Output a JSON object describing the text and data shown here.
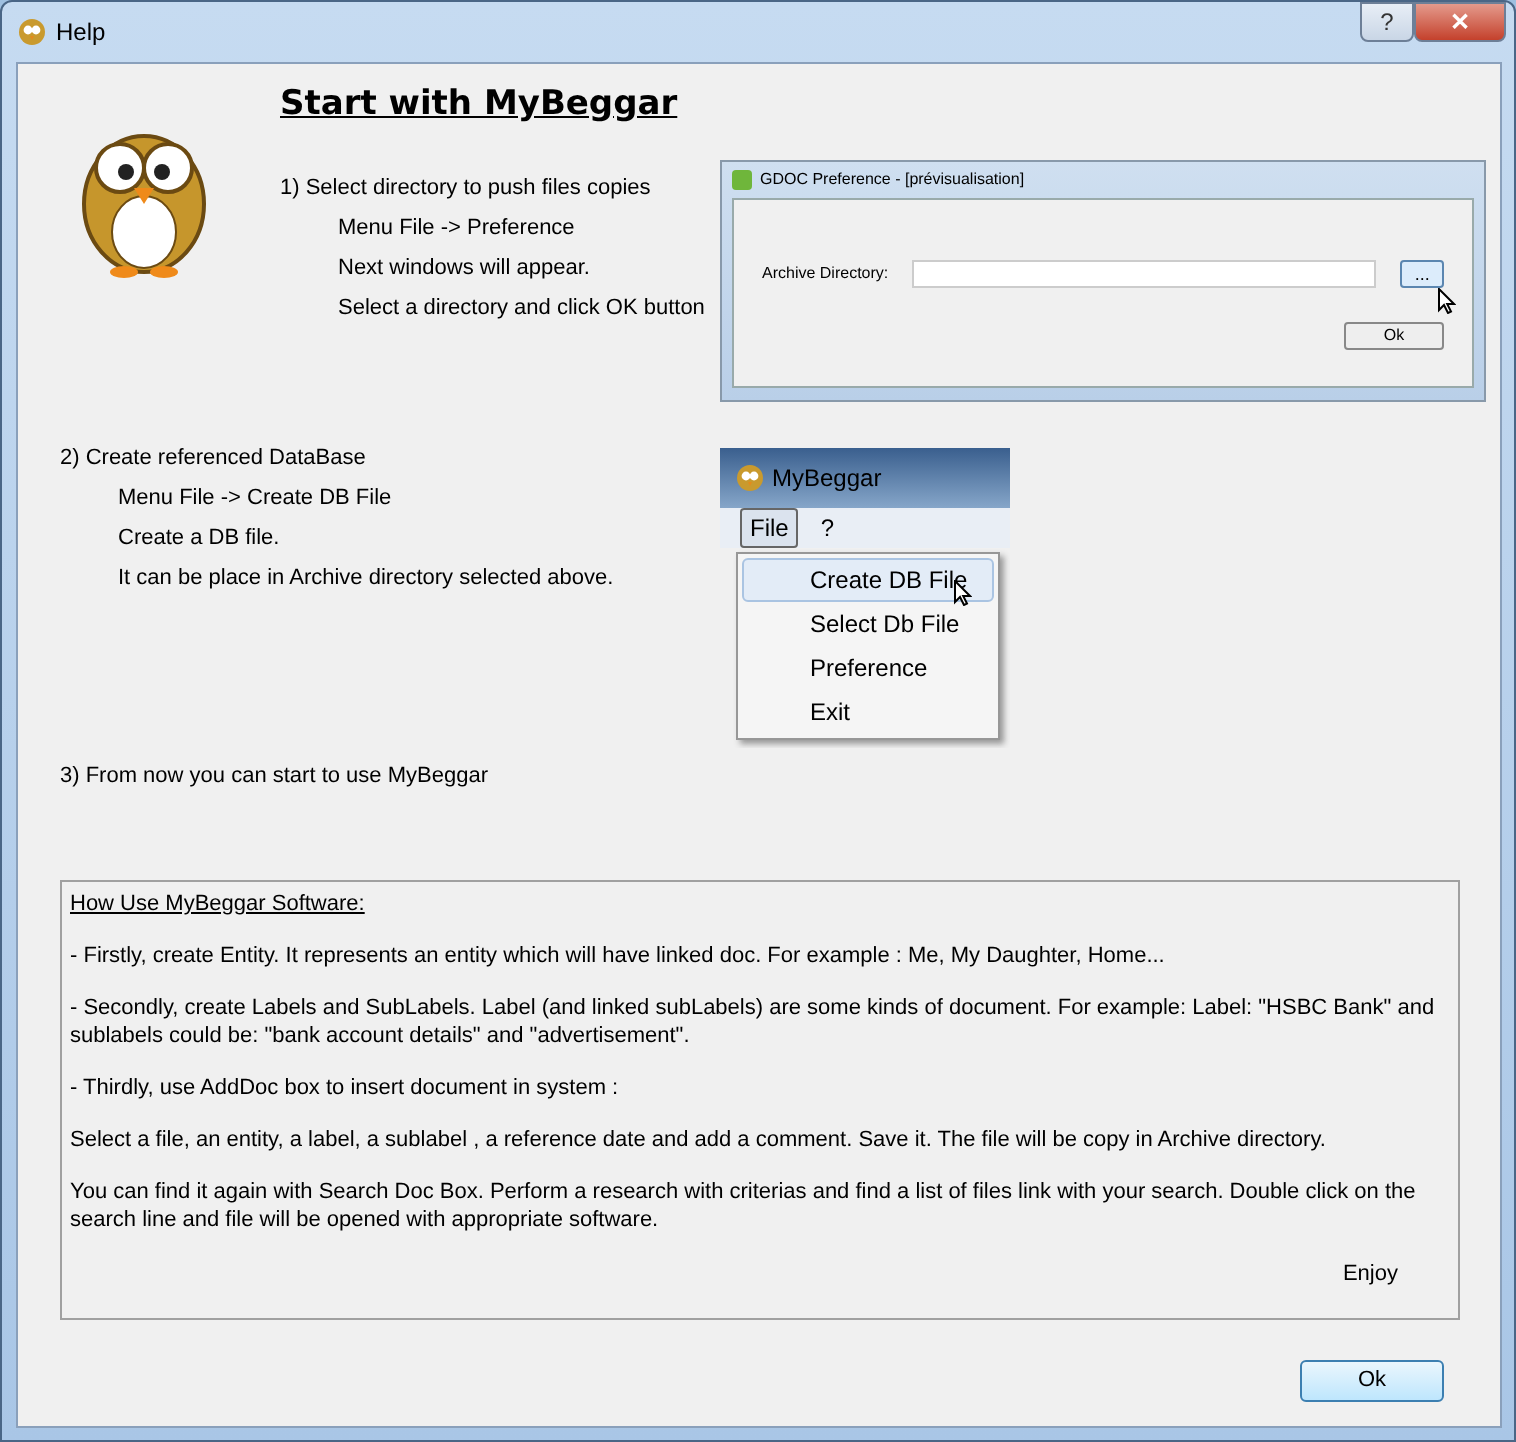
{
  "window": {
    "title": "Help",
    "buttons": [
      {
        "kind": "help",
        "label": "?"
      },
      {
        "kind": "close",
        "label": "✕"
      }
    ]
  },
  "heading": "Start with MyBeggar",
  "steps": [
    {
      "title": "1) Select directory to push files copies",
      "lines": [
        "Menu File -> Preference",
        "Next windows will appear.",
        "Select a directory and click OK button"
      ]
    },
    {
      "title": "2) Create referenced DataBase",
      "lines": [
        "Menu File -> Create DB File",
        "Create a DB file.",
        " It can be place in Archive directory selected above."
      ]
    },
    {
      "title": "3) From now you can start to use MyBeggar"
    }
  ],
  "preference_screenshot": {
    "title": "GDOC Preference - [prévisualisation]",
    "field_label": "Archive Directory:",
    "browse_button": "...",
    "ok_button": "Ok"
  },
  "menu_screenshot": {
    "title": "MyBeggar",
    "menubar": [
      {
        "label": "File",
        "selected": true
      },
      {
        "label": "?",
        "selected": false
      }
    ],
    "menu_items": [
      {
        "label": "Create DB File",
        "selected": true
      },
      {
        "label": "Select Db File",
        "selected": false
      },
      {
        "label": "Preference",
        "selected": false
      },
      {
        "label": "Exit",
        "selected": false
      }
    ]
  },
  "help_box": {
    "heading": "How Use MyBeggar Software:",
    "paragraphs": [
      "- Firstly, create Entity. It represents an entity which will have linked doc. For example : Me, My Daughter, Home...",
      "- Secondly, create Labels and SubLabels. Label (and linked subLabels) are some kinds of document. For example: Label: \"HSBC Bank\" and sublabels could be: \"bank account details\" and \"advertisement\".",
      "- Thirdly, use AddDoc box to insert document in system :",
      "Select a file, an entity, a label, a sublabel , a reference date and add a comment. Save it. The file will be copy in Archive directory.",
      "You can find it again with Search Doc Box. Perform a research with criterias and find a list of files link with your search. Double click on the search line and file will be opened with appropriate software."
    ],
    "signature": "Enjoy"
  },
  "ok_button": "Ok"
}
